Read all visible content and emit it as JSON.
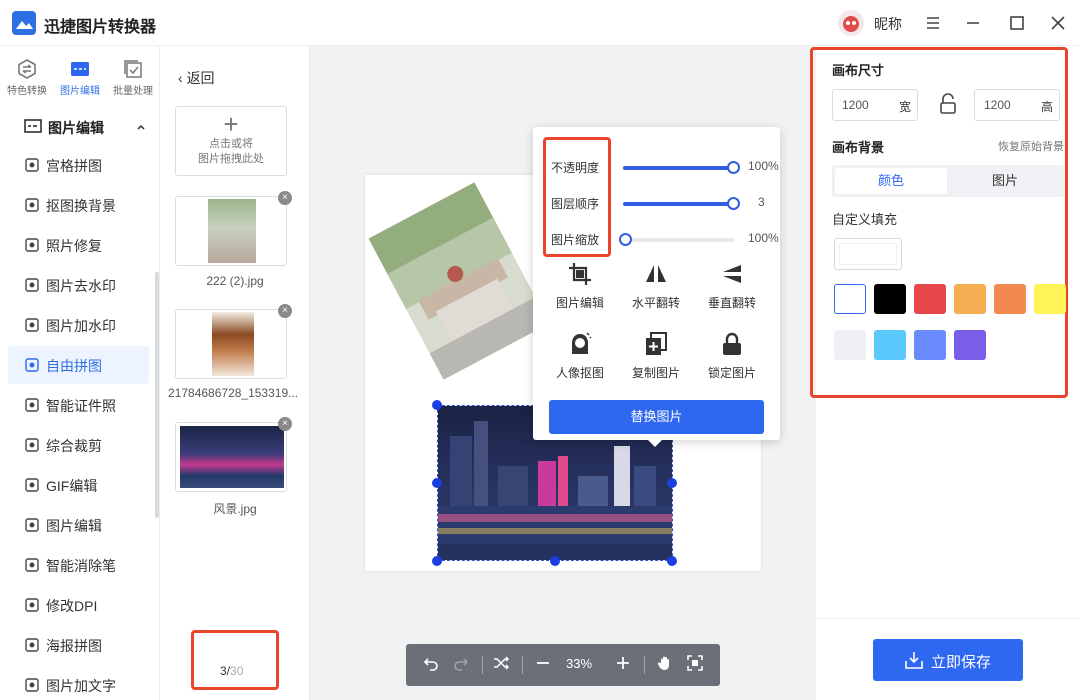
{
  "app": {
    "title": "迅捷图片转换器",
    "user_name": "昵称"
  },
  "mode_tabs": [
    {
      "label": "特色转换",
      "icon": "convert-icon"
    },
    {
      "label": "图片编辑",
      "icon": "image-edit-icon"
    },
    {
      "label": "批量处理",
      "icon": "batch-icon"
    }
  ],
  "sidebar": {
    "group_label": "图片编辑",
    "items": [
      {
        "label": "宫格拼图",
        "icon": "grid-icon"
      },
      {
        "label": "抠图换背景",
        "icon": "cutout-icon"
      },
      {
        "label": "照片修复",
        "icon": "repair-icon"
      },
      {
        "label": "图片去水印",
        "icon": "remove-watermark-icon"
      },
      {
        "label": "图片加水印",
        "icon": "add-watermark-icon"
      },
      {
        "label": "自由拼图",
        "icon": "collage-icon"
      },
      {
        "label": "智能证件照",
        "icon": "id-photo-icon"
      },
      {
        "label": "综合裁剪",
        "icon": "crop-icon"
      },
      {
        "label": "GIF编辑",
        "icon": "gif-icon"
      },
      {
        "label": "图片编辑",
        "icon": "picture-edit-icon"
      },
      {
        "label": "智能消除笔",
        "icon": "eraser-pen-icon"
      },
      {
        "label": "修改DPI",
        "icon": "dpi-icon"
      },
      {
        "label": "海报拼图",
        "icon": "poster-icon"
      },
      {
        "label": "图片加文字",
        "icon": "add-text-icon"
      }
    ],
    "active_index": 5
  },
  "files": {
    "back_label": "返回",
    "uploader_line1": "点击或将",
    "uploader_line2": "图片拖拽此处",
    "items": [
      {
        "name": "222 (2).jpg"
      },
      {
        "name": "21784686728_153319..."
      },
      {
        "name": "风景.jpg"
      }
    ],
    "pager_current": "3/",
    "pager_total": "30"
  },
  "popup": {
    "sliders": [
      {
        "label": "不透明度",
        "value": "100%",
        "level": 1.0
      },
      {
        "label": "图层顺序",
        "value": "3",
        "level": 1.0
      },
      {
        "label": "图片缩放",
        "value": "100%",
        "level": 0.0
      }
    ],
    "tools": [
      {
        "label": "图片编辑",
        "icon": "crop-frame-icon"
      },
      {
        "label": "水平翻转",
        "icon": "flip-horizontal-icon"
      },
      {
        "label": "垂直翻转",
        "icon": "flip-vertical-icon"
      },
      {
        "label": "人像抠图",
        "icon": "portrait-cutout-icon"
      },
      {
        "label": "复制图片",
        "icon": "copy-image-icon"
      },
      {
        "label": "锁定图片",
        "icon": "lock-icon"
      }
    ],
    "replace_label": "替换图片"
  },
  "toolbar": {
    "zoom": "33%"
  },
  "right_panel": {
    "canvas_size_title": "画布尺寸",
    "width_value": "1200",
    "width_unit": "宽",
    "height_value": "1200",
    "height_unit": "高",
    "background_title": "画布背景",
    "reset_label": "恢复原始背景",
    "tab_color": "颜色",
    "tab_image": "图片",
    "custom_fill_label": "自定义填充",
    "swatches": [
      "#ffffff",
      "#000000",
      "#e5474b",
      "#f5ad52",
      "#f28a50",
      "#fef457",
      "#eef0f3",
      "#5ac8fa",
      "#6a8bfb",
      "#7a5ee8"
    ],
    "save_label": "立即保存"
  },
  "colors": {
    "accent": "#2f68f0",
    "highlight": "#e8452c"
  }
}
